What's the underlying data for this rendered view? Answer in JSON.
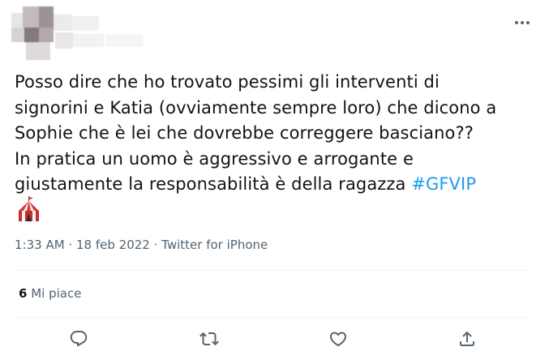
{
  "tweet": {
    "text": "Posso dire che ho trovato pessimi gli interventi di\nsignorini e Katia (ovviamente sempre loro) che dicono a\nSophie che è lei che dovrebbe correggere basciano??\nIn pratica un uomo è aggressivo e arrogante e\ngiustamente la responsabilità è della ragazza ",
    "hashtag": "#GFVIP",
    "emoji_icon": "circus-tent-icon"
  },
  "meta": {
    "time": "1:33 AM",
    "sep1": "·",
    "date": "18 feb 2022",
    "sep2": "·",
    "source": "Twitter for iPhone"
  },
  "stats": {
    "likes_count": "6",
    "likes_label": "Mi piace"
  },
  "actions": {
    "reply_icon": "reply-icon",
    "retweet_icon": "retweet-icon",
    "like_icon": "heart-icon",
    "share_icon": "share-icon",
    "more_icon": "more-horizontal-icon"
  },
  "colors": {
    "text": "#0f1419",
    "secondary": "#536471",
    "link": "#1d9bf0",
    "divider": "#eff3f4"
  }
}
